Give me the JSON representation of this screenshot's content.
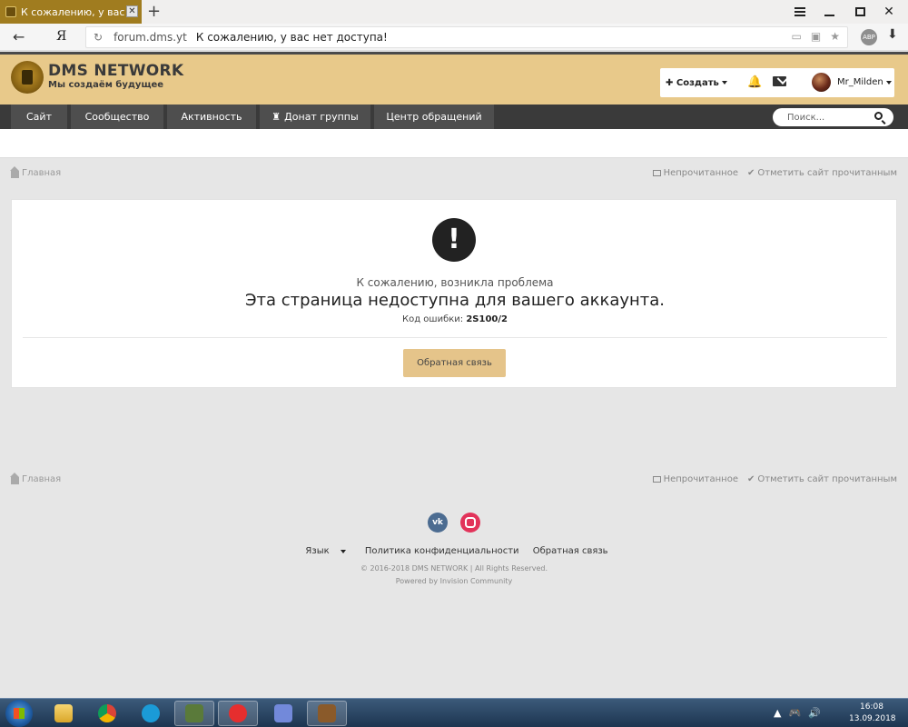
{
  "browser": {
    "tab_title": "К сожалению, у вас нет д",
    "tab_close": "✕",
    "new_tab": "+",
    "back": "←",
    "yandex": "Я",
    "reload": "↻",
    "host": "forum.dms.yt",
    "page_title": "К сожалению, у вас нет доступа!",
    "abp": "ABP",
    "download": "⬇"
  },
  "site": {
    "logo_title": "DMS NETWORK",
    "logo_tagline": "Мы создаём будущее",
    "create_label": "Создать",
    "create_plus": "✚",
    "bell": "🔔",
    "username": "Mr_Milden",
    "nav": [
      {
        "label": "Сайт"
      },
      {
        "label": "Сообщество"
      },
      {
        "label": "Активность"
      },
      {
        "label": "Донат группы"
      },
      {
        "label": "Центр обращений"
      }
    ],
    "search_placeholder": "Поиск..."
  },
  "breadcrumb": {
    "home": "Главная",
    "unread": "Непрочитанное",
    "check": "✔",
    "mark_read": "Отметить сайт прочитанным"
  },
  "error": {
    "icon": "!",
    "subtitle": "К сожалению, возникла проблема",
    "message": "Эта страница недоступна для вашего аккаунта.",
    "code_label": "Код ошибки: ",
    "code_value": "2S100/2",
    "feedback_button": "Обратная связь"
  },
  "footer": {
    "vk": "vk",
    "language": "Язык",
    "privacy": "Политика конфиденциальности",
    "feedback": "Обратная связь",
    "copyright": "© 2016-2018 DMS NETWORK | All Rights Reserved.",
    "powered": "Powered by Invision Community"
  },
  "taskbar": {
    "time": "16:08",
    "date": "13.09.2018",
    "tray": [
      "▲",
      "🎮",
      "🔊"
    ]
  },
  "colors": {
    "header_bg": "#e8c98a",
    "nav_bg": "#3a3a3a",
    "button_bg": "#e5c48a",
    "tab_bg": "#a07c1f"
  }
}
